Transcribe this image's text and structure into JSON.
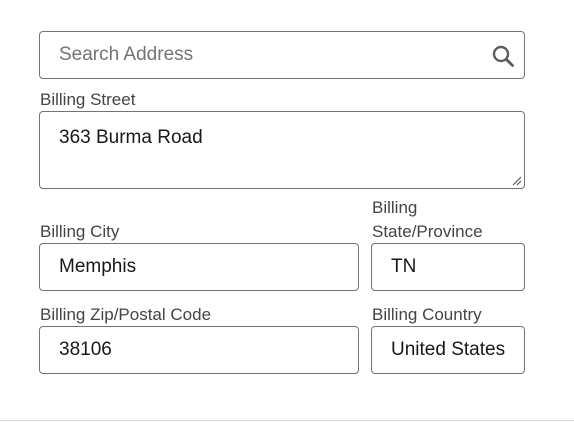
{
  "search": {
    "placeholder": "Search Address",
    "value": "",
    "icon": "search-icon"
  },
  "billing_street": {
    "label": "Billing Street",
    "value": "363 Burma Road"
  },
  "billing_city": {
    "label": "Billing City",
    "value": "Memphis"
  },
  "billing_state": {
    "label_line1": "Billing",
    "label_line2": "State/Province",
    "value": "TN"
  },
  "billing_zip": {
    "label": "Billing Zip/Postal Code",
    "value": "38106"
  },
  "billing_country": {
    "label": "Billing Country",
    "value": "United States"
  },
  "colors": {
    "border": "#747474",
    "label": "#444444",
    "text": "#181818",
    "placeholder": "#747474"
  }
}
